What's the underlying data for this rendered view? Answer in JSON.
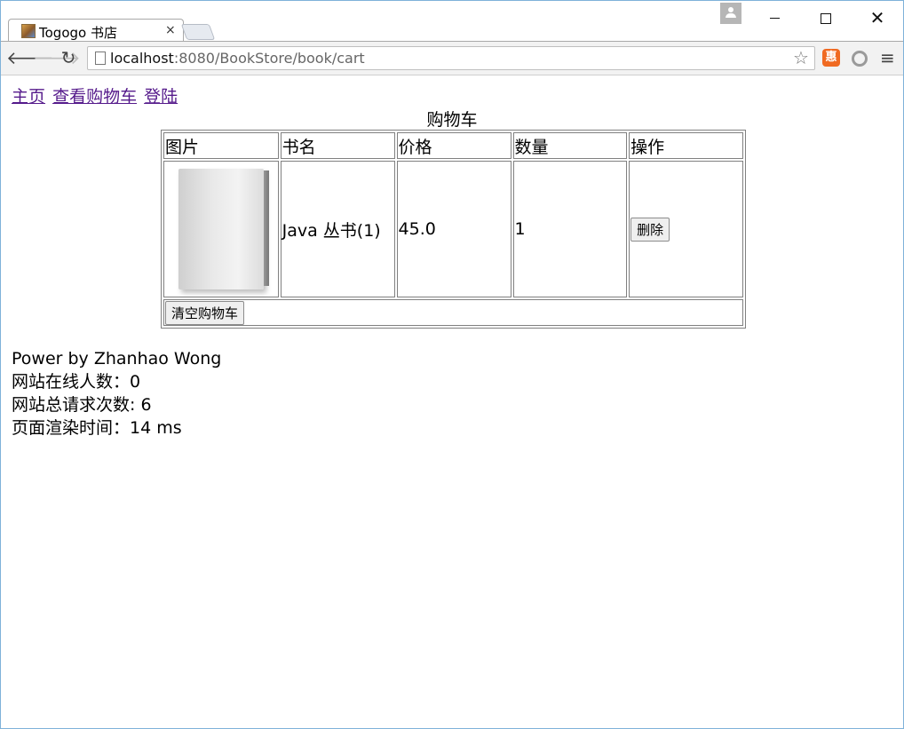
{
  "browser": {
    "tab_title": "Togogo 书店",
    "tab_close": "×",
    "url_host": "localhost",
    "url_rest": ":8080/BookStore/book/cart",
    "window_close": "✕"
  },
  "nav": {
    "home": "主页",
    "view_cart": "查看购物车",
    "login": "登陆"
  },
  "cart": {
    "caption": "购物车",
    "headers": [
      "图片",
      "书名",
      "价格",
      "数量",
      "操作"
    ],
    "rows": [
      {
        "name": "Java 丛书(1)",
        "price": "45.0",
        "quantity": "1",
        "delete_label": "删除"
      }
    ],
    "clear_label": "清空购物车"
  },
  "footer": {
    "powered": "Power by Zhanhao Wong",
    "online": "网站在线人数：0",
    "requests": "网站总请求次数: 6",
    "render_time": "页面渲染时间：14 ms"
  }
}
